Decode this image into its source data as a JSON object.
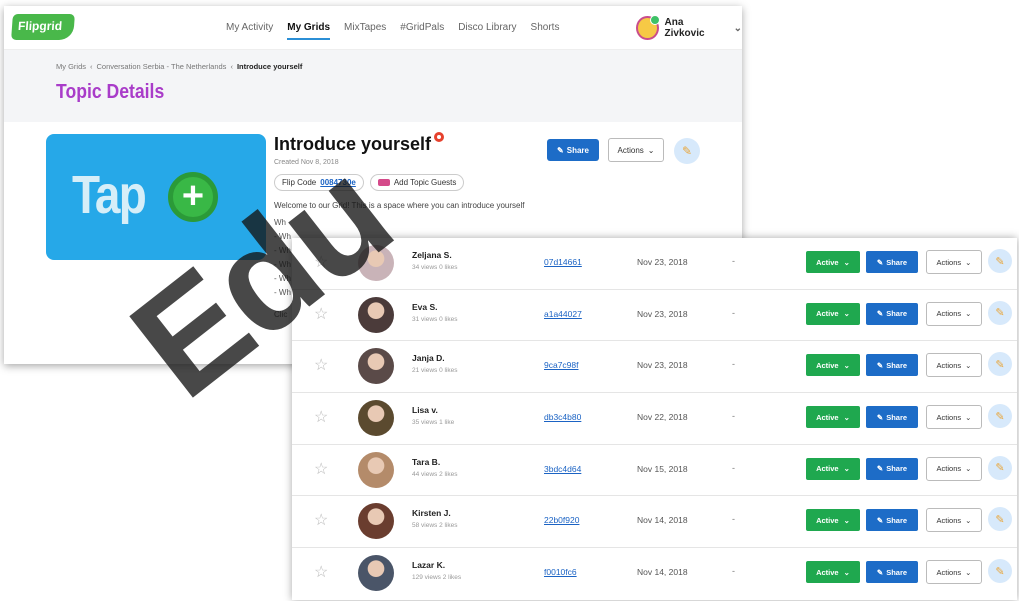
{
  "nav": {
    "logo": "Flipgrid",
    "links": [
      "My Activity",
      "My Grids",
      "MixTapes",
      "#GridPals",
      "Disco Library",
      "Shorts"
    ],
    "user_name": "Ana Zivkovic"
  },
  "breadcrumb": [
    "My Grids",
    "Conversation Serbia - The Netherlands",
    "Introduce yourself"
  ],
  "page_title": "Topic Details",
  "topic": {
    "thumb_text": "Tap",
    "title": "Introduce yourself",
    "created": "Created Nov 8, 2018",
    "flip_code_label": "Flip Code",
    "flip_code": "0084730e",
    "add_guests": "Add Topic Guests",
    "welcome": "Welcome to our Grid! This is a space where you can introduce yourself",
    "bullets_heading": "Wh",
    "bullets": [
      "- Wh",
      "- Wh",
      "- Wh",
      "- Wh",
      "- Wh"
    ],
    "footer": "Clic",
    "share": "Share",
    "actions": "Actions"
  },
  "responses": [
    {
      "name": "Zeljana S.",
      "meta": "34 views  0 likes",
      "code": "07d14661",
      "date": "Nov 23, 2018",
      "dash": "-",
      "status": "Active",
      "share": "Share",
      "actions": "Actions",
      "avatar_color": "#c9b3b8"
    },
    {
      "name": "Eva S.",
      "meta": "31 views  0 likes",
      "code": "a1a44027",
      "date": "Nov 23, 2018",
      "dash": "-",
      "status": "Active",
      "share": "Share",
      "actions": "Actions",
      "avatar_color": "#4b3b3a"
    },
    {
      "name": "Janja D.",
      "meta": "21 views  0 likes",
      "code": "9ca7c98f",
      "date": "Nov 23, 2018",
      "dash": "-",
      "status": "Active",
      "share": "Share",
      "actions": "Actions",
      "avatar_color": "#5a4a48"
    },
    {
      "name": "Lisa v.",
      "meta": "35 views  1 like",
      "code": "db3c4b80",
      "date": "Nov 22, 2018",
      "dash": "-",
      "status": "Active",
      "share": "Share",
      "actions": "Actions",
      "avatar_color": "#5b4a2f"
    },
    {
      "name": "Tara B.",
      "meta": "44 views  2 likes",
      "code": "3bdc4d64",
      "date": "Nov 15, 2018",
      "dash": "-",
      "status": "Active",
      "share": "Share",
      "actions": "Actions",
      "avatar_color": "#b48b6a"
    },
    {
      "name": "Kirsten J.",
      "meta": "58 views  2 likes",
      "code": "22b0f920",
      "date": "Nov 14, 2018",
      "dash": "-",
      "status": "Active",
      "share": "Share",
      "actions": "Actions",
      "avatar_color": "#6a3d2f"
    },
    {
      "name": "Lazar K.",
      "meta": "129 views  2 likes",
      "code": "f0010fc6",
      "date": "Nov 14, 2018",
      "dash": "-",
      "status": "Active",
      "share": "Share",
      "actions": "Actions",
      "avatar_color": "#4a5568"
    }
  ],
  "watermark": "Edu"
}
